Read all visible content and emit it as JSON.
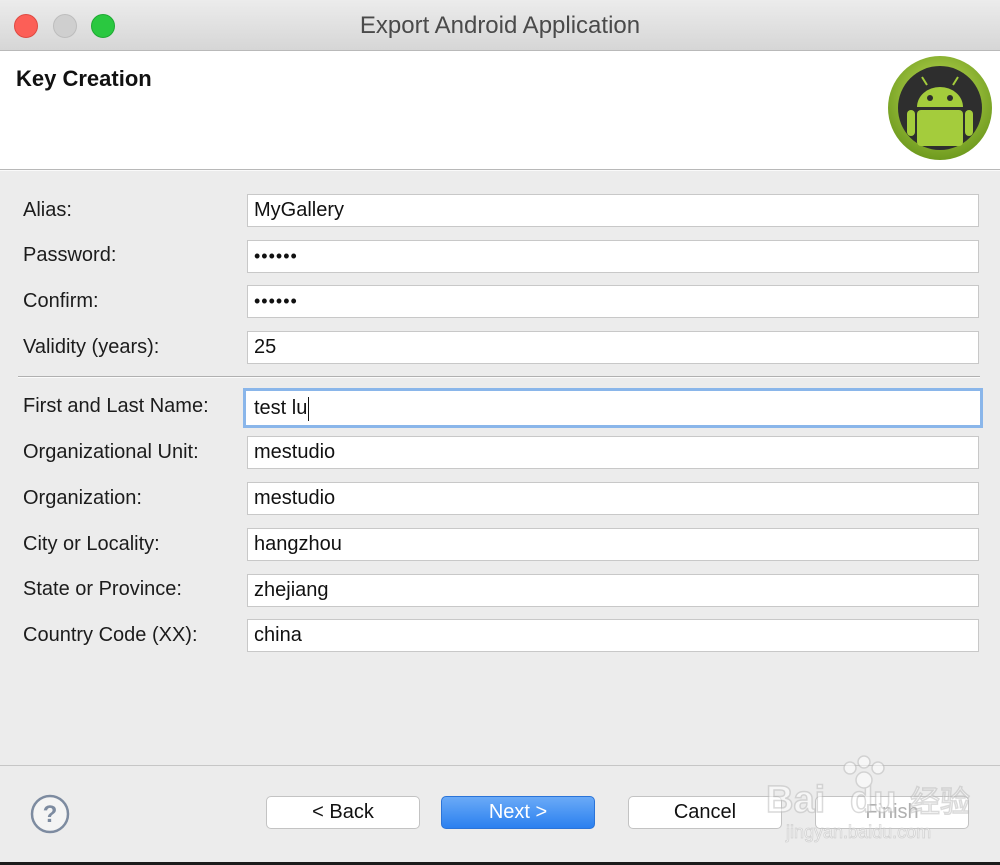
{
  "window": {
    "title": "Export Android Application"
  },
  "header": {
    "title": "Key Creation",
    "logo_icon": "android-logo-icon"
  },
  "fields": [
    {
      "label": "Alias:",
      "value": "MyGallery"
    },
    {
      "label": "Password:",
      "value": "••••••"
    },
    {
      "label": "Confirm:",
      "value": "••••••"
    },
    {
      "label": "Validity (years):",
      "value": "25"
    },
    {
      "label": "First and Last Name:",
      "value": "test lu"
    },
    {
      "label": "Organizational Unit:",
      "value": "mestudio"
    },
    {
      "label": "Organization:",
      "value": "mestudio"
    },
    {
      "label": "City or Locality:",
      "value": "hangzhou"
    },
    {
      "label": "State or Province:",
      "value": "zhejiang"
    },
    {
      "label": "Country Code (XX):",
      "value": "china"
    }
  ],
  "buttons": {
    "back": "< Back",
    "next": "Next >",
    "cancel": "Cancel",
    "finish": "Finish"
  },
  "help_icon": "question-mark-icon",
  "watermark": {
    "brand": "Baidu",
    "cn": "经验",
    "url": "jingyan.baidu.com"
  },
  "colors": {
    "focus_ring": "#8ab6ea",
    "primary_button": "#2b80ef",
    "close": "#fc5f57",
    "maximize": "#2ac840"
  }
}
